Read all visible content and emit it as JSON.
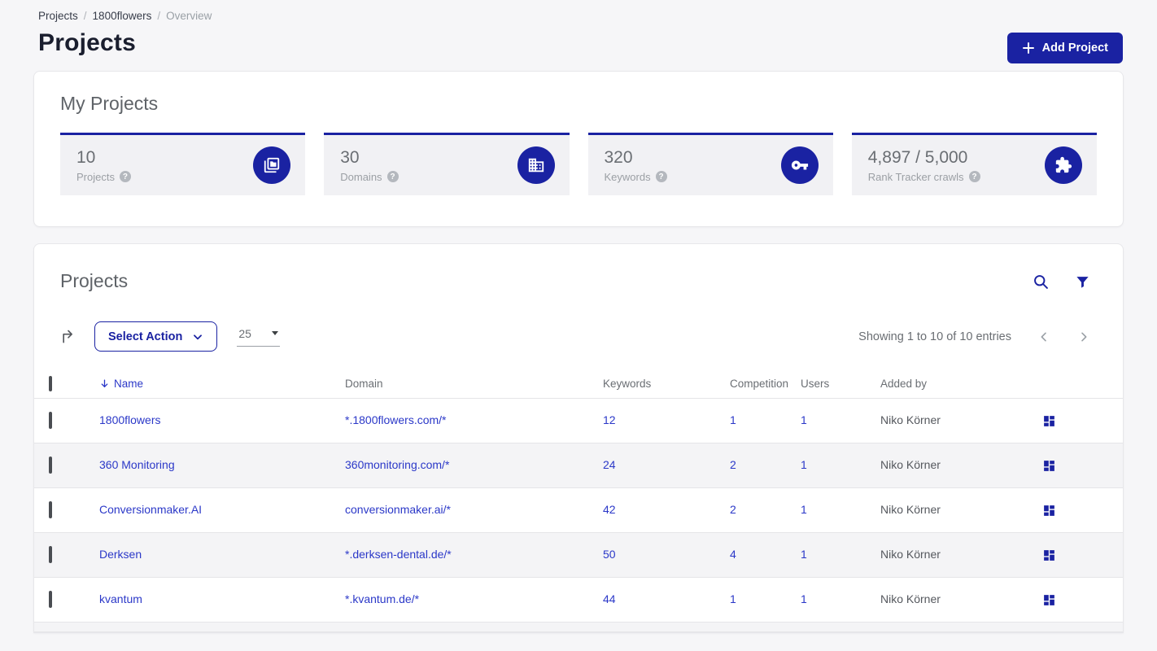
{
  "breadcrumb": {
    "items": [
      "Projects",
      "1800flowers",
      "Overview"
    ],
    "separator": "/"
  },
  "page": {
    "title": "Projects"
  },
  "header": {
    "add_project_label": "Add Project"
  },
  "icons": {
    "help_glyph": "?"
  },
  "my_projects": {
    "title": "My Projects",
    "stats": [
      {
        "value": "10",
        "label": "Projects",
        "icon": "projects-copy-icon"
      },
      {
        "value": "30",
        "label": "Domains",
        "icon": "building-icon"
      },
      {
        "value": "320",
        "label": "Keywords",
        "icon": "key-icon"
      },
      {
        "value": "4,897 / 5,000",
        "label": "Rank Tracker crawls",
        "icon": "puzzle-icon"
      }
    ]
  },
  "projects_panel": {
    "title": "Projects",
    "toolbar": {
      "select_action_label": "Select Action",
      "page_size": "25",
      "showing_text": "Showing 1 to 10 of 10 entries"
    },
    "table": {
      "columns": {
        "name": "Name",
        "domain": "Domain",
        "keywords": "Keywords",
        "competition": "Competition",
        "users": "Users",
        "added_by": "Added by"
      },
      "rows": [
        {
          "name": "1800flowers",
          "domain": "*.1800flowers.com/*",
          "keywords": "12",
          "competition": "1",
          "users": "1",
          "added_by": "Niko Körner"
        },
        {
          "name": "360 Monitoring",
          "domain": "360monitoring.com/*",
          "keywords": "24",
          "competition": "2",
          "users": "1",
          "added_by": "Niko Körner"
        },
        {
          "name": "Conversionmaker.AI",
          "domain": "conversionmaker.ai/*",
          "keywords": "42",
          "competition": "2",
          "users": "1",
          "added_by": "Niko Körner"
        },
        {
          "name": "Derksen",
          "domain": "*.derksen-dental.de/*",
          "keywords": "50",
          "competition": "4",
          "users": "1",
          "added_by": "Niko Körner"
        },
        {
          "name": "kvantum",
          "domain": "*.kvantum.de/*",
          "keywords": "44",
          "competition": "1",
          "users": "1",
          "added_by": "Niko Körner"
        }
      ]
    }
  },
  "colors": {
    "brand_blue": "#1a22a2",
    "link_blue": "#2b38c8",
    "title_navy": "#1a1e2e",
    "stripe_gray": "#f4f4f6"
  }
}
